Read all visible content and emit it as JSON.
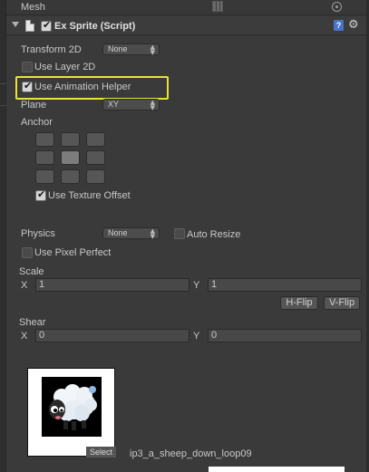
{
  "mesh": {
    "label": "Mesh"
  },
  "component": {
    "title": "Ex Sprite (Script)",
    "help_icon": "?",
    "enabled": true
  },
  "transform2d": {
    "label": "Transform 2D",
    "value": "None"
  },
  "use_layer_2d": {
    "label": "Use Layer 2D",
    "checked": false
  },
  "use_animation_helper": {
    "label": "Use Animation Helper",
    "checked": true
  },
  "plane": {
    "label": "Plane",
    "value": "XY"
  },
  "anchor": {
    "label": "Anchor",
    "selected": "middle-center"
  },
  "use_texture_offset": {
    "label": "Use Texture Offset",
    "checked": true
  },
  "physics": {
    "label": "Physics",
    "value": "None"
  },
  "auto_resize": {
    "label": "Auto Resize",
    "checked": false
  },
  "use_pixel_perfect": {
    "label": "Use Pixel Perfect",
    "checked": false
  },
  "scale": {
    "label": "Scale",
    "x_label": "X",
    "x": "1",
    "y_label": "Y",
    "y": "1",
    "hflip": "H-Flip",
    "vflip": "V-Flip"
  },
  "shear": {
    "label": "Shear",
    "x_label": "X",
    "x": "0",
    "y_label": "Y",
    "y": "0"
  },
  "texture": {
    "name": "ip3_a_sheep_down_loop09",
    "select": "Select"
  },
  "colors": {
    "highlight": "#e8e434",
    "background": "#3a3a3a"
  }
}
